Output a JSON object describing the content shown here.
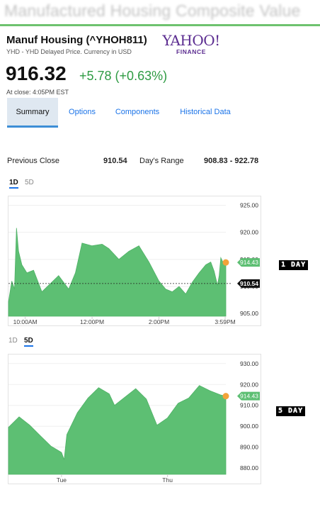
{
  "banner": {
    "text": "Manufactured Housing Composite Value"
  },
  "quote": {
    "name": "Manuf Housing (^YHOH811)",
    "subtitle": "YHD - YHD Delayed Price. Currency in USD",
    "price": "916.32",
    "change": "+5.78 (+0.63%)",
    "close_time": "At close: 4:05PM EST"
  },
  "logo": {
    "word": "YAHOO!",
    "sub": "FINANCE"
  },
  "tabs": [
    {
      "label": "Summary",
      "active": true
    },
    {
      "label": "Options"
    },
    {
      "label": "Components"
    },
    {
      "label": "Historical Data"
    }
  ],
  "stats": {
    "prev_close_label": "Previous Close",
    "prev_close_value": "910.54",
    "days_range_label": "Day's Range",
    "days_range_value": "908.83 - 922.78"
  },
  "colors": {
    "area": "#5dbf73",
    "dot": "#f2a33a",
    "accent": "#1a73e8",
    "price_tag": "#5dbf73"
  },
  "chart_data": [
    {
      "type": "area",
      "range_options": [
        "1D",
        "5D"
      ],
      "selected_range": "1D",
      "y_ticks": [
        "925.00",
        "920.00",
        "915.00",
        "910.00",
        "905.00"
      ],
      "ylim": [
        904.5,
        926.5
      ],
      "x_ticks": [
        "10:00AM",
        "12:00PM",
        "2:00PM",
        "3:59PM"
      ],
      "x_tick_positions": [
        0.5,
        2.5,
        4.5,
        6.48
      ],
      "xlim": [
        0,
        6.5
      ],
      "last_price_label": "914.43",
      "last_price": 914.43,
      "prev_close_label": "910.54",
      "prev_close": 910.54,
      "badge": "1 DAY",
      "x": [
        0,
        0.1,
        0.18,
        0.24,
        0.3,
        0.4,
        0.55,
        0.75,
        1.0,
        1.25,
        1.5,
        1.8,
        2.0,
        2.2,
        2.5,
        2.8,
        3.0,
        3.3,
        3.6,
        3.9,
        4.2,
        4.5,
        4.7,
        4.9,
        5.1,
        5.3,
        5.5,
        5.7,
        5.9,
        6.05,
        6.15,
        6.25,
        6.3,
        6.35,
        6.45,
        6.5
      ],
      "y": [
        907.2,
        911.0,
        909.5,
        920.8,
        916.5,
        914.0,
        912.5,
        913.0,
        909.0,
        910.5,
        912.0,
        909.5,
        912.5,
        918.0,
        917.5,
        917.8,
        917.0,
        915.0,
        916.5,
        917.5,
        914.5,
        911.0,
        909.5,
        909.0,
        910.0,
        908.6,
        910.8,
        912.5,
        914.0,
        914.5,
        912.8,
        910.2,
        912.0,
        915.3,
        914.0,
        914.43
      ]
    },
    {
      "type": "area",
      "range_options": [
        "1D",
        "5D"
      ],
      "selected_range": "5D",
      "y_ticks": [
        "930.00",
        "920.00",
        "910.00",
        "900.00",
        "890.00",
        "880.00"
      ],
      "ylim": [
        877,
        934
      ],
      "x_ticks": [
        "Tue",
        "Thu"
      ],
      "x_tick_positions": [
        1.0,
        3.0
      ],
      "xlim": [
        0,
        4.1
      ],
      "last_price_label": "914.43",
      "last_price": 914.43,
      "badge": "5 DAY",
      "x": [
        0,
        0.2,
        0.4,
        0.6,
        0.8,
        1.0,
        1.05,
        1.1,
        1.3,
        1.5,
        1.7,
        1.9,
        2.0,
        2.2,
        2.4,
        2.6,
        2.8,
        3.0,
        3.2,
        3.4,
        3.6,
        3.8,
        4.0,
        4.1
      ],
      "y": [
        899.5,
        904.5,
        900.5,
        895.5,
        890.5,
        887.5,
        884.0,
        896.0,
        906.5,
        913.5,
        918.5,
        915.5,
        910.0,
        914.0,
        918.0,
        913.0,
        900.5,
        904.0,
        911.0,
        913.5,
        919.5,
        917.0,
        915.0,
        914.43
      ]
    }
  ]
}
